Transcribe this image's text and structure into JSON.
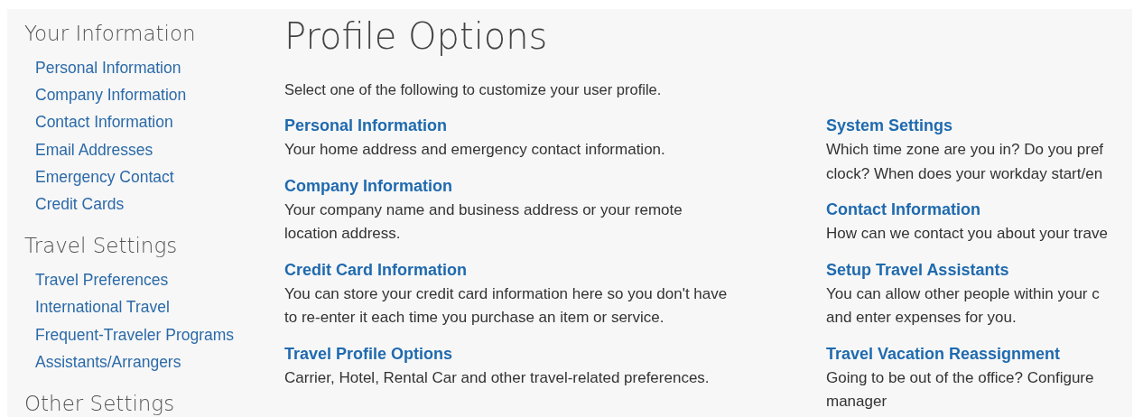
{
  "sidebar": {
    "sections": [
      {
        "heading": "Your Information",
        "items": [
          {
            "label": "Personal Information"
          },
          {
            "label": "Company Information"
          },
          {
            "label": "Contact Information"
          },
          {
            "label": "Email Addresses"
          },
          {
            "label": "Emergency Contact"
          },
          {
            "label": "Credit Cards"
          }
        ]
      },
      {
        "heading": "Travel Settings",
        "items": [
          {
            "label": "Travel Preferences"
          },
          {
            "label": "International Travel"
          },
          {
            "label": "Frequent-Traveler Programs"
          },
          {
            "label": "Assistants/Arrangers"
          }
        ]
      },
      {
        "heading": "Other Settings"
      }
    ]
  },
  "main": {
    "title": "Profile Options",
    "intro": "Select one of the following to customize your user profile.",
    "columns": [
      [
        {
          "title": "Personal Information",
          "lines": [
            "Your home address and emergency contact information."
          ]
        },
        {
          "title": "Company Information",
          "lines": [
            "Your company name and business address or your remote",
            "location address."
          ]
        },
        {
          "title": "Credit Card Information",
          "lines": [
            "You can store your credit card information here so you don't have",
            "to re-enter it each time you purchase an item or service."
          ]
        },
        {
          "title": "Travel Profile Options",
          "lines": [
            "Carrier, Hotel, Rental Car and other travel-related preferences."
          ]
        }
      ],
      [
        {
          "title": "System Settings",
          "lines": [
            "Which time zone are you in? Do you pref",
            "clock? When does your workday start/en"
          ]
        },
        {
          "title": "Contact Information",
          "lines": [
            "How can we contact you about your trave"
          ]
        },
        {
          "title": "Setup Travel Assistants",
          "lines": [
            "You can allow other people within your c",
            "and enter expenses for you."
          ]
        },
        {
          "title": "Travel Vacation Reassignment",
          "lines": [
            "Going to be out of the office? Configure",
            "manager"
          ]
        }
      ]
    ]
  }
}
